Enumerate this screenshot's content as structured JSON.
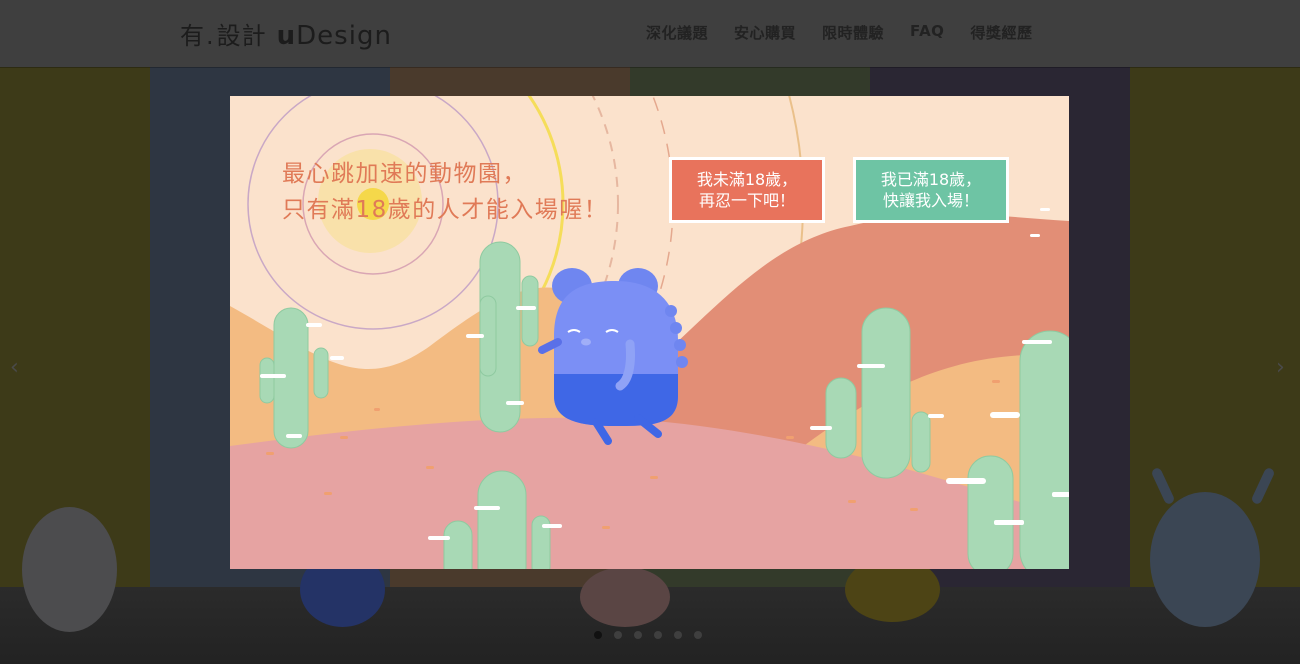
{
  "header": {
    "logo_zh": "有",
    "logo_dot": ".",
    "logo_zh2": "設計",
    "logo_en_bold": "u",
    "logo_en_rest": "Design",
    "nav": [
      "深化議題",
      "安心購買",
      "限時體驗",
      "FAQ",
      "得獎經歷"
    ]
  },
  "slider": {
    "prev_arrow": "‹",
    "next_arrow": "›",
    "dot_count": 6,
    "active_dot": 1
  },
  "modal": {
    "title_line1": "最心跳加速的動物園，",
    "title_line2": "只有滿18歲的人才能入場喔！",
    "button_no_line1": "我未滿18歲，",
    "button_no_line2": "再忍一下吧！",
    "button_yes_line1": "我已滿18歲，",
    "button_yes_line2": "快讓我入場！"
  },
  "colors": {
    "modal_bg": "#fbe2cc",
    "title": "#e07a57",
    "button_no": "#e8735c",
    "button_yes": "#6ec4a4",
    "character": "#6f86f0",
    "cactus": "#a8d9b5"
  },
  "icons": [
    "chevron-left-icon",
    "chevron-right-icon",
    "monster-illustration",
    "cactus-illustration"
  ]
}
